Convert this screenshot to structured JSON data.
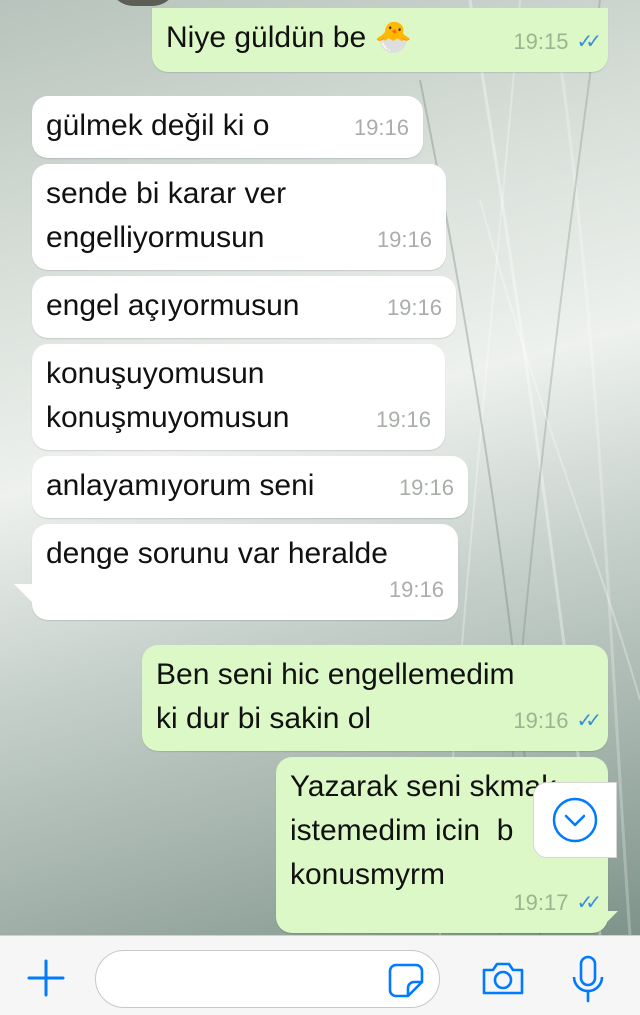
{
  "messages": [
    {
      "id": "m1",
      "direction": "out",
      "text": "Niye güldün be 🐣",
      "time": "19:15",
      "read": true
    },
    {
      "id": "m2",
      "direction": "in",
      "text": "gülmek değil ki o",
      "time": "19:16"
    },
    {
      "id": "m3",
      "direction": "in",
      "text": "sende bi karar ver\nengelliyormusun",
      "time": "19:16"
    },
    {
      "id": "m4",
      "direction": "in",
      "text": "engel açıyormusun",
      "time": "19:16"
    },
    {
      "id": "m5",
      "direction": "in",
      "text": "konuşuyomusun\nkonuşmuyomusun",
      "time": "19:16"
    },
    {
      "id": "m6",
      "direction": "in",
      "text": "anlayamıyorum seni",
      "time": "19:16"
    },
    {
      "id": "m7",
      "direction": "in",
      "text": "denge sorunu var heralde",
      "time": "19:16"
    },
    {
      "id": "m8",
      "direction": "out",
      "text": "Ben seni hic engellemedim\nki dur bi sakin ol",
      "time": "19:16",
      "read": true
    },
    {
      "id": "m9",
      "direction": "out",
      "text": "Yazarak seni skmak\nistemedim icin  b\nkonusmyrm",
      "time": "19:17",
      "read": true
    }
  ],
  "read_ticks": "✓✓",
  "input": {
    "placeholder": "",
    "value": ""
  },
  "icons": {
    "attach": "plus-icon",
    "sticker": "sticker-icon",
    "camera": "camera-icon",
    "microphone": "microphone-icon",
    "scroll_down": "chevron-down-circle-icon"
  },
  "colors": {
    "incoming_bubble": "#ffffff",
    "outgoing_bubble": "#dcf8c6",
    "accent": "#007aff",
    "read_ticks": "#3a8fd8"
  }
}
